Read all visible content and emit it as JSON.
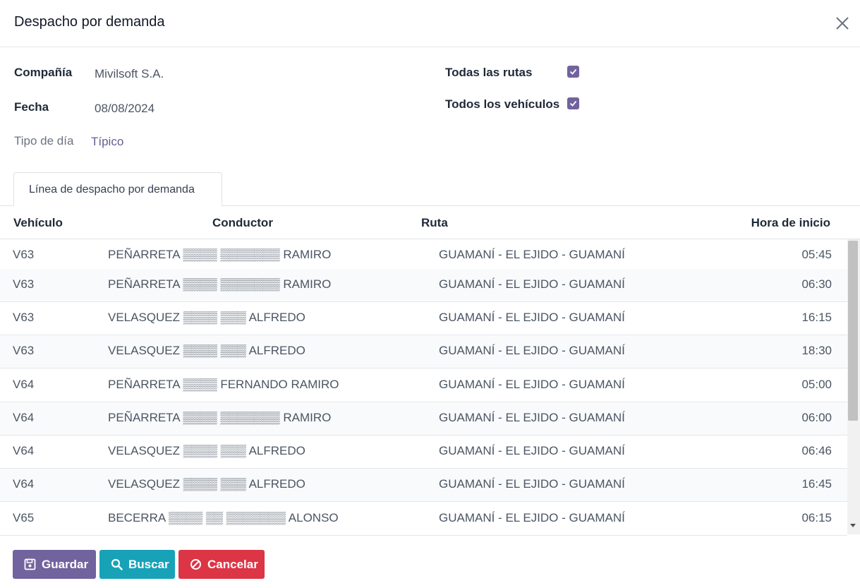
{
  "dialog": {
    "title": "Despacho por demanda"
  },
  "form": {
    "company_label": "Compañía",
    "company_value": "Mivilsoft S.A.",
    "date_label": "Fecha",
    "date_value": "08/08/2024",
    "day_type_label": "Tipo de día",
    "day_type_value": "Típico",
    "all_routes_label": "Todas las rutas",
    "all_routes_checked": true,
    "all_vehicles_label": "Todos los vehículos",
    "all_vehicles_checked": true
  },
  "tabs": [
    {
      "label": "Línea de despacho por demanda",
      "active": true
    }
  ],
  "table": {
    "headers": {
      "vehicle": "Vehículo",
      "driver": "Conductor",
      "route": "Ruta",
      "start_time": "Hora de inicio"
    },
    "rows": [
      {
        "vehicle": "V63",
        "driver": "PEÑARRETA ▒▒▒▒ ▒▒▒▒▒▒▒ RAMIRO",
        "route": "GUAMANÍ - EL EJIDO - GUAMANÍ",
        "start_time": "05:45"
      },
      {
        "vehicle": "V63",
        "driver": "PEÑARRETA ▒▒▒▒ ▒▒▒▒▒▒▒ RAMIRO",
        "route": "GUAMANÍ - EL EJIDO - GUAMANÍ",
        "start_time": "06:30"
      },
      {
        "vehicle": "V63",
        "driver": "VELASQUEZ ▒▒▒▒ ▒▒▒ ALFREDO",
        "route": "GUAMANÍ - EL EJIDO - GUAMANÍ",
        "start_time": "16:15"
      },
      {
        "vehicle": "V63",
        "driver": "VELASQUEZ ▒▒▒▒ ▒▒▒ ALFREDO",
        "route": "GUAMANÍ - EL EJIDO - GUAMANÍ",
        "start_time": "18:30"
      },
      {
        "vehicle": "V64",
        "driver": "PEÑARRETA ▒▒▒▒ FERNANDO RAMIRO",
        "route": "GUAMANÍ - EL EJIDO - GUAMANÍ",
        "start_time": "05:00"
      },
      {
        "vehicle": "V64",
        "driver": "PEÑARRETA ▒▒▒▒ ▒▒▒▒▒▒▒ RAMIRO",
        "route": "GUAMANÍ - EL EJIDO - GUAMANÍ",
        "start_time": "06:00"
      },
      {
        "vehicle": "V64",
        "driver": "VELASQUEZ ▒▒▒▒ ▒▒▒ ALFREDO",
        "route": "GUAMANÍ - EL EJIDO - GUAMANÍ",
        "start_time": "06:46"
      },
      {
        "vehicle": "V64",
        "driver": "VELASQUEZ ▒▒▒▒ ▒▒▒ ALFREDO",
        "route": "GUAMANÍ - EL EJIDO - GUAMANÍ",
        "start_time": "16:45"
      },
      {
        "vehicle": "V65",
        "driver": "BECERRA ▒▒▒▒ ▒▒ ▒▒▒▒▒▒▒ ALONSO",
        "route": "GUAMANÍ - EL EJIDO - GUAMANÍ",
        "start_time": "06:15"
      }
    ]
  },
  "footer": {
    "save_label": "Guardar",
    "search_label": "Buscar",
    "cancel_label": "Cancelar"
  },
  "colors": {
    "primary": "#71639e",
    "info": "#17a2b8",
    "danger": "#dc3545"
  }
}
